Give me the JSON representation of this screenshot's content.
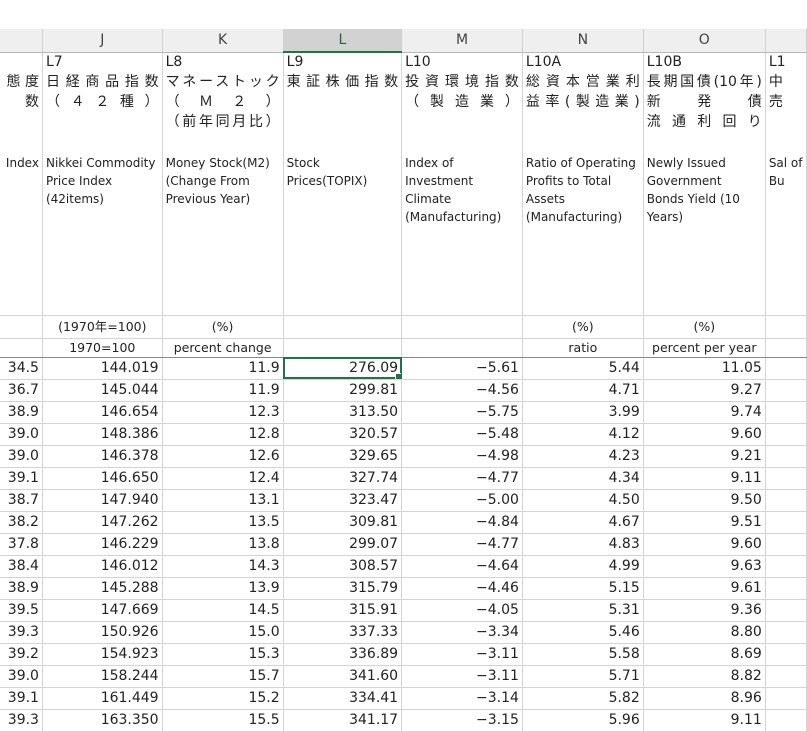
{
  "columns": [
    {
      "letter": "",
      "code": "",
      "jp": "態 度\n数",
      "en": "Index",
      "unit": "",
      "unit2": ""
    },
    {
      "letter": "J",
      "code": "L7",
      "jp": "日経商品指数\n（ ４ ２ 種 ）",
      "en": "Nikkei Commodity Price Index (42items)",
      "unit": "(1970年=100)",
      "unit2": "1970=100"
    },
    {
      "letter": "K",
      "code": "L8",
      "jp": "マネーストック\n（ Ｍ ２ ）\n（前年同月比）",
      "en": "Money Stock(M2) (Change From Previous Year)",
      "unit": "(%)",
      "unit2": "percent change"
    },
    {
      "letter": "L",
      "code": "L9",
      "jp": "東証株価指数",
      "en": "Stock Prices(TOPIX)",
      "unit": "",
      "unit2": ""
    },
    {
      "letter": "M",
      "code": "L10",
      "jp": "投資環境指数\n（ 製 造 業 ）",
      "en": "Index of Investment Climate (Manufacturing)",
      "unit": "",
      "unit2": ""
    },
    {
      "letter": "N",
      "code": "L10A",
      "jp": "総資本営業利\n益率(製造業)",
      "en": "Ratio of Operating Profits to Total Assets (Manufacturing)",
      "unit": "(%)",
      "unit2": "ratio"
    },
    {
      "letter": "O",
      "code": "L10B",
      "jp": "長期国債(10年)\n新 発 債\n流 通 利 回 り",
      "en": "Newly Issued Government Bonds Yield (10 Years)",
      "unit": "(%)",
      "unit2": "percent per year"
    },
    {
      "letter": "",
      "code": "L1",
      "jp": "中\n売",
      "en": "Sal of Bu",
      "unit": "",
      "unit2": ""
    }
  ],
  "rows": [
    [
      "34.5",
      "144.019",
      "11.9",
      "276.09",
      "−5.61",
      "5.44",
      "11.05",
      ""
    ],
    [
      "36.7",
      "145.044",
      "11.9",
      "299.81",
      "−4.56",
      "4.71",
      "9.27",
      ""
    ],
    [
      "38.9",
      "146.654",
      "12.3",
      "313.50",
      "−5.75",
      "3.99",
      "9.74",
      ""
    ],
    [
      "39.0",
      "148.386",
      "12.8",
      "320.57",
      "−5.48",
      "4.12",
      "9.60",
      ""
    ],
    [
      "39.0",
      "146.378",
      "12.6",
      "329.65",
      "−4.98",
      "4.23",
      "9.21",
      ""
    ],
    [
      "39.1",
      "146.650",
      "12.4",
      "327.74",
      "−4.77",
      "4.34",
      "9.11",
      ""
    ],
    [
      "38.7",
      "147.940",
      "13.1",
      "323.47",
      "−5.00",
      "4.50",
      "9.50",
      ""
    ],
    [
      "38.2",
      "147.262",
      "13.5",
      "309.81",
      "−4.84",
      "4.67",
      "9.51",
      ""
    ],
    [
      "37.8",
      "146.229",
      "13.8",
      "299.07",
      "−4.77",
      "4.83",
      "9.60",
      ""
    ],
    [
      "38.4",
      "146.012",
      "14.3",
      "308.57",
      "−4.64",
      "4.99",
      "9.63",
      ""
    ],
    [
      "38.9",
      "145.288",
      "13.9",
      "315.79",
      "−4.46",
      "5.15",
      "9.61",
      ""
    ],
    [
      "39.5",
      "147.669",
      "14.5",
      "315.91",
      "−4.05",
      "5.31",
      "9.36",
      ""
    ],
    [
      "39.3",
      "150.926",
      "15.0",
      "337.33",
      "−3.34",
      "5.46",
      "8.80",
      ""
    ],
    [
      "39.2",
      "154.923",
      "15.3",
      "336.89",
      "−3.11",
      "5.58",
      "8.69",
      ""
    ],
    [
      "39.0",
      "158.244",
      "15.7",
      "341.60",
      "−3.11",
      "5.71",
      "8.82",
      ""
    ],
    [
      "39.1",
      "161.449",
      "15.2",
      "334.41",
      "−3.14",
      "5.82",
      "8.96",
      ""
    ],
    [
      "39.3",
      "163.350",
      "15.5",
      "341.17",
      "−3.15",
      "5.96",
      "9.11",
      ""
    ]
  ],
  "selected": {
    "column": "L",
    "row_index": 0
  },
  "colors": {
    "accent": "#217346",
    "header_bg": "#efefef",
    "active_header_bg": "#d2d2d2"
  }
}
